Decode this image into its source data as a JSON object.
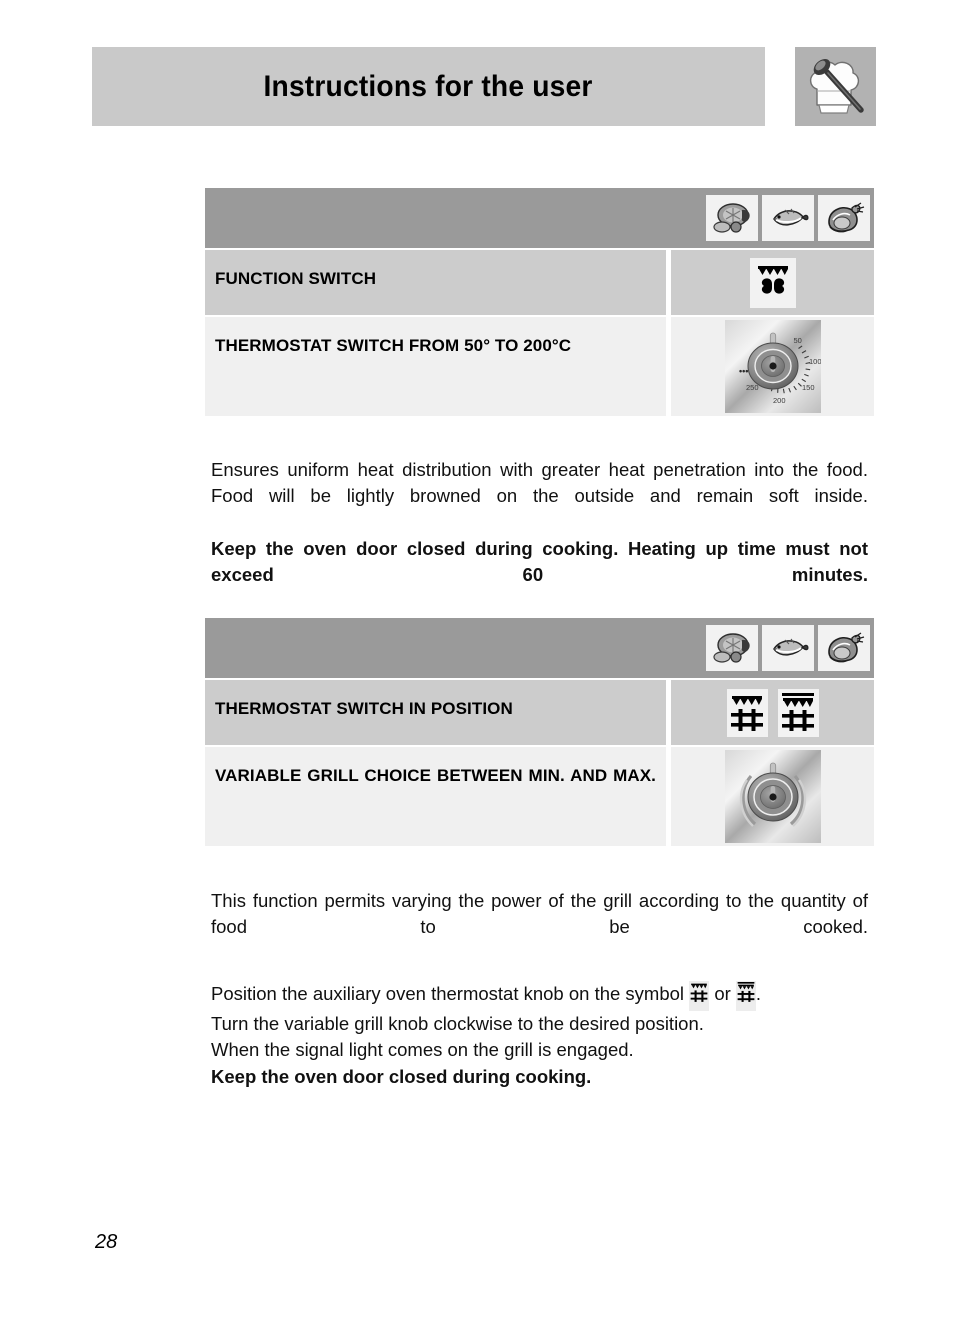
{
  "header": {
    "title": "Instructions for the user",
    "logo_icon": "chef-hat-spoon-icon"
  },
  "food_icons": [
    {
      "name": "roast-meat-icon",
      "label": "roast meat"
    },
    {
      "name": "fish-icon",
      "label": "fish"
    },
    {
      "name": "poultry-icon",
      "label": "poultry"
    }
  ],
  "blocks": [
    {
      "id": "fan-oven",
      "rows": [
        {
          "label": "FUNCTION SWITCH",
          "justify": false,
          "icon_kind": "symbols",
          "symbols": [
            "fan-with-top-element-icon"
          ]
        },
        {
          "label": "THERMOSTAT SWITCH FROM 50° TO 200°C",
          "justify": false,
          "icon_kind": "thermostat-knob",
          "knob": {
            "name": "thermostat-knob-image",
            "ticks": [
              "50",
              "100",
              "150",
              "200",
              "250"
            ],
            "off_mark": "•••"
          }
        }
      ],
      "paragraph": [
        {
          "text": "Ensures uniform heat distribution with greater heat penetration into the food. Food will be lightly browned on the outside and remain soft inside.",
          "bold": false,
          "justify": true,
          "gap": false
        },
        {
          "text": "Keep the oven door closed during cooking. Heating up time must not exceed 60 minutes.",
          "bold": true,
          "justify": true,
          "gap": false
        }
      ]
    },
    {
      "id": "variable-grill",
      "rows": [
        {
          "label": "THERMOSTAT SWITCH IN POSITION",
          "justify": false,
          "icon_kind": "symbols",
          "symbols": [
            "small-grill-icon",
            "large-grill-icon"
          ]
        },
        {
          "label": "VARIABLE GRILL CHOICE BETWEEN MIN. AND MAX.",
          "justify": true,
          "icon_kind": "grill-knob",
          "knob": {
            "name": "variable-grill-knob-image"
          }
        }
      ],
      "paragraph": [
        {
          "text": "This function permits varying the power of the grill according to the quantity of food to be cooked.",
          "bold": false,
          "justify": true,
          "gap": false
        },
        {
          "text_before": "Position the auxiliary oven thermostat knob on the symbol ",
          "text_middle": " or ",
          "text_after": ".",
          "inline_symbols": [
            "small-grill-icon",
            "large-grill-icon"
          ],
          "bold": false,
          "justify": false,
          "gap": true
        },
        {
          "text": "Turn the variable grill knob clockwise to the desired position.",
          "bold": false,
          "justify": false,
          "gap": false
        },
        {
          "text": "When the signal light comes on the grill is engaged.",
          "bold": false,
          "justify": false,
          "gap": false
        },
        {
          "text": "Keep the oven door closed during cooking.",
          "bold": true,
          "justify": false,
          "gap": false
        }
      ]
    }
  ],
  "footer": {
    "page_number": "28"
  },
  "colors": {
    "band": "#9a9a9a",
    "row_mid": "#cccccc",
    "row_light": "#f0f0f0",
    "header_bar": "#c9c9c9",
    "logo_bg": "#b2b2b2"
  }
}
